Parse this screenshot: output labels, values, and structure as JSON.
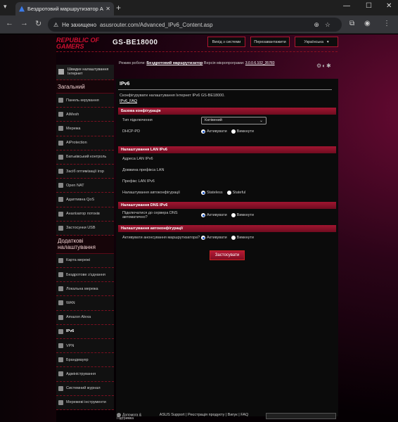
{
  "browser": {
    "tab_title": "Бездротовий маршрутизатор A",
    "url": "asusrouter.com/Advanced_IPv6_Content.asp",
    "security": "Не захищено"
  },
  "header": {
    "brand_line1": "REPUBLIC OF",
    "brand_line2": "GAMERS",
    "model": "GS-BE18000",
    "logout": "Вихід з системи",
    "reboot": "Перезавантажити",
    "language": "Українська"
  },
  "status": {
    "mode_label": "Режим роботи:",
    "mode_value": "Бездротовий маршрутизатор",
    "fw_label": "Версія мікропрограми:",
    "fw_value": "3.0.0.6.102_35783"
  },
  "sidebar": {
    "qis": "Швидке налаштування Інтернет",
    "group1": "Загальний",
    "general": [
      "Панель керування",
      "AiMesh",
      "Мережа",
      "AiProtection",
      "Батьківський контроль",
      "Засіб оптимізації ігор",
      "Open NAT",
      "Адаптивна QoS",
      "Аналізатор потоків",
      "Застосунки USB"
    ],
    "group2": "Додаткові налаштування",
    "advanced": [
      "Карта мережі",
      "Бездротове з'єднання",
      "Локальна мережа",
      "WAN",
      "Amazon Alexa",
      "IPv6",
      "VPN",
      "Брандмауер",
      "Адміністрування",
      "Системний журнал",
      "Мережеві інструменти"
    ]
  },
  "main": {
    "title": "IPv6",
    "desc": "Сконфігурувати налаштування Інтернет IPv6 GS-BE18000.",
    "links": "IPv6_FAQ",
    "sec_basic": "Базова конфігурація",
    "conn_type_label": "Тип підключення",
    "conn_type_value": "Катівений",
    "dhcp_pd_label": "DHCP-PD",
    "enable": "Активувати",
    "disable": "Вимкнути",
    "sec_lan": "Налаштування LAN IPv6",
    "lan_addr": "Адреса LAN IPv6",
    "prefix_len": "Довжина префікса LAN",
    "lan_prefix": "Префікс LAN IPv6",
    "autoconf": "Налаштування автоконфігурації",
    "stateless": "Stateless",
    "stateful": "Stateful",
    "sec_dns": "Налаштування DNS IPv6",
    "dns_auto": "Підключатися до сервера DNS автоматично?",
    "sec_auto": "Налаштування автоконфігурації",
    "router_adv": "Активувати анонсування маршрутизатора?",
    "apply": "Застосувати"
  },
  "footer": {
    "help": "Допомога & Підтримка",
    "links": "ASUS Support | Реєстрація продукту | Вигук | FAQ"
  }
}
